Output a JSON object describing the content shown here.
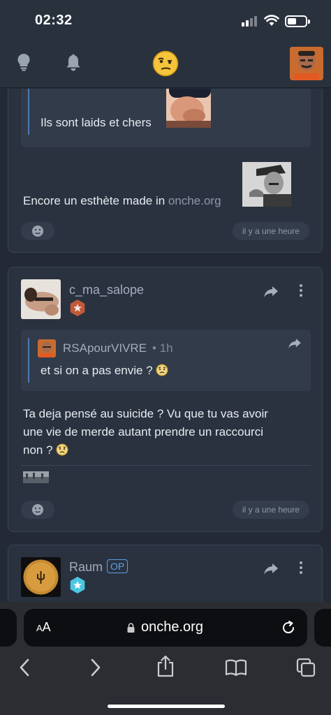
{
  "status": {
    "time": "02:32"
  },
  "nav": {
    "icons": [
      "lightbulb-icon",
      "bell-icon",
      "logo-smiley",
      "user-avatar"
    ]
  },
  "posts": [
    {
      "quote_text": "Ils sont laids et chers",
      "body_text": "Encore un esthète made in",
      "body_link": "onche.org",
      "time": "il y a une heure"
    },
    {
      "username": "c_ma_salope",
      "quote_author": "RSApourVIVRE",
      "quote_time": "• 1h",
      "quote_text": "et si on a pas envie ?",
      "body_lines": [
        "Ta deja pensé au suicide ? Vu que tu vas avoir",
        "une vie de merde autant prendre un raccourci",
        "non ?"
      ],
      "time": "il y a une heure"
    },
    {
      "username": "Raum",
      "op_label": "OP"
    }
  ],
  "browser": {
    "text_size_label_small": "A",
    "text_size_label": "A",
    "url": "onche.org"
  },
  "colors": {
    "background": "#232a35",
    "card": "#2a3240",
    "link": "#8d98a8",
    "op": "#5aa0e6"
  }
}
